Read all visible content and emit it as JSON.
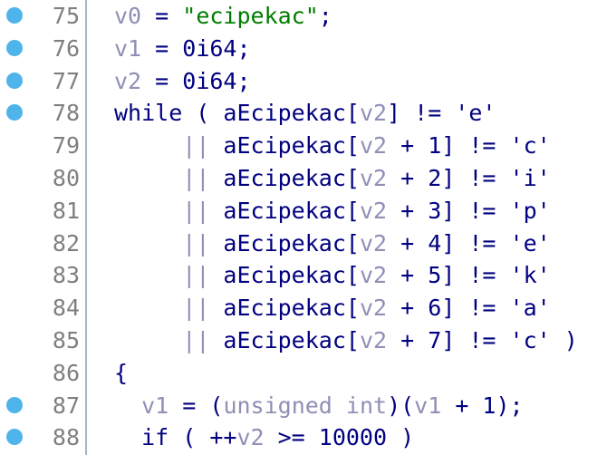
{
  "editor": {
    "lines": [
      {
        "number": "75",
        "breakpoint": true,
        "indent": "",
        "tokens": [
          {
            "t": "v0",
            "c": "var"
          },
          {
            "t": " = ",
            "c": "op"
          },
          {
            "t": "\"ecipekac\"",
            "c": "str"
          },
          {
            "t": ";",
            "c": "op"
          }
        ]
      },
      {
        "number": "76",
        "breakpoint": true,
        "indent": "",
        "tokens": [
          {
            "t": "v1",
            "c": "var"
          },
          {
            "t": " = 0i64;",
            "c": "op"
          }
        ]
      },
      {
        "number": "77",
        "breakpoint": true,
        "indent": "",
        "tokens": [
          {
            "t": "v2",
            "c": "var"
          },
          {
            "t": " = 0i64;",
            "c": "op"
          }
        ]
      },
      {
        "number": "78",
        "breakpoint": true,
        "indent": "",
        "tokens": [
          {
            "t": "while ( aEcipekac[",
            "c": "kw"
          },
          {
            "t": "v2",
            "c": "var"
          },
          {
            "t": "] != 'e'",
            "c": "op"
          }
        ]
      },
      {
        "number": "79",
        "breakpoint": false,
        "indent": "     ",
        "tokens": [
          {
            "t": "||",
            "c": "var"
          },
          {
            "t": " aEcipekac[",
            "c": "op"
          },
          {
            "t": "v2",
            "c": "var"
          },
          {
            "t": " + 1] != 'c'",
            "c": "op"
          }
        ]
      },
      {
        "number": "80",
        "breakpoint": false,
        "indent": "     ",
        "tokens": [
          {
            "t": "||",
            "c": "var"
          },
          {
            "t": " aEcipekac[",
            "c": "op"
          },
          {
            "t": "v2",
            "c": "var"
          },
          {
            "t": " + 2] != 'i'",
            "c": "op"
          }
        ]
      },
      {
        "number": "81",
        "breakpoint": false,
        "indent": "     ",
        "tokens": [
          {
            "t": "||",
            "c": "var"
          },
          {
            "t": " aEcipekac[",
            "c": "op"
          },
          {
            "t": "v2",
            "c": "var"
          },
          {
            "t": " + 3] != 'p'",
            "c": "op"
          }
        ]
      },
      {
        "number": "82",
        "breakpoint": false,
        "indent": "     ",
        "tokens": [
          {
            "t": "||",
            "c": "var"
          },
          {
            "t": " aEcipekac[",
            "c": "op"
          },
          {
            "t": "v2",
            "c": "var"
          },
          {
            "t": " + 4] != 'e'",
            "c": "op"
          }
        ]
      },
      {
        "number": "83",
        "breakpoint": false,
        "indent": "     ",
        "tokens": [
          {
            "t": "||",
            "c": "var"
          },
          {
            "t": " aEcipekac[",
            "c": "op"
          },
          {
            "t": "v2",
            "c": "var"
          },
          {
            "t": " + 5] != 'k'",
            "c": "op"
          }
        ]
      },
      {
        "number": "84",
        "breakpoint": false,
        "indent": "     ",
        "tokens": [
          {
            "t": "||",
            "c": "var"
          },
          {
            "t": " aEcipekac[",
            "c": "op"
          },
          {
            "t": "v2",
            "c": "var"
          },
          {
            "t": " + 6] != 'a'",
            "c": "op"
          }
        ]
      },
      {
        "number": "85",
        "breakpoint": false,
        "indent": "     ",
        "tokens": [
          {
            "t": "||",
            "c": "var"
          },
          {
            "t": " aEcipekac[",
            "c": "op"
          },
          {
            "t": "v2",
            "c": "var"
          },
          {
            "t": " + 7] != 'c' )",
            "c": "op"
          }
        ]
      },
      {
        "number": "86",
        "breakpoint": false,
        "indent": "",
        "tokens": [
          {
            "t": "{",
            "c": "op"
          }
        ]
      },
      {
        "number": "87",
        "breakpoint": true,
        "indent": "  ",
        "tokens": [
          {
            "t": "v1",
            "c": "var"
          },
          {
            "t": " = (",
            "c": "op"
          },
          {
            "t": "unsigned int",
            "c": "var"
          },
          {
            "t": ")(",
            "c": "op"
          },
          {
            "t": "v1",
            "c": "var"
          },
          {
            "t": " + 1);",
            "c": "op"
          }
        ]
      },
      {
        "number": "88",
        "breakpoint": true,
        "indent": "  ",
        "tokens": [
          {
            "t": "if ( ++",
            "c": "kw"
          },
          {
            "t": "v2",
            "c": "var"
          },
          {
            "t": " >= 10000 )",
            "c": "op"
          }
        ]
      }
    ]
  },
  "colors": {
    "background": "#ffffff",
    "line_number": "#7f7f7f",
    "breakpoint": "#4fb4ea",
    "code_default": "#000080",
    "variable": "#8f8fb7",
    "string": "#007c00",
    "gutter_separator": "#a8b6c8"
  }
}
